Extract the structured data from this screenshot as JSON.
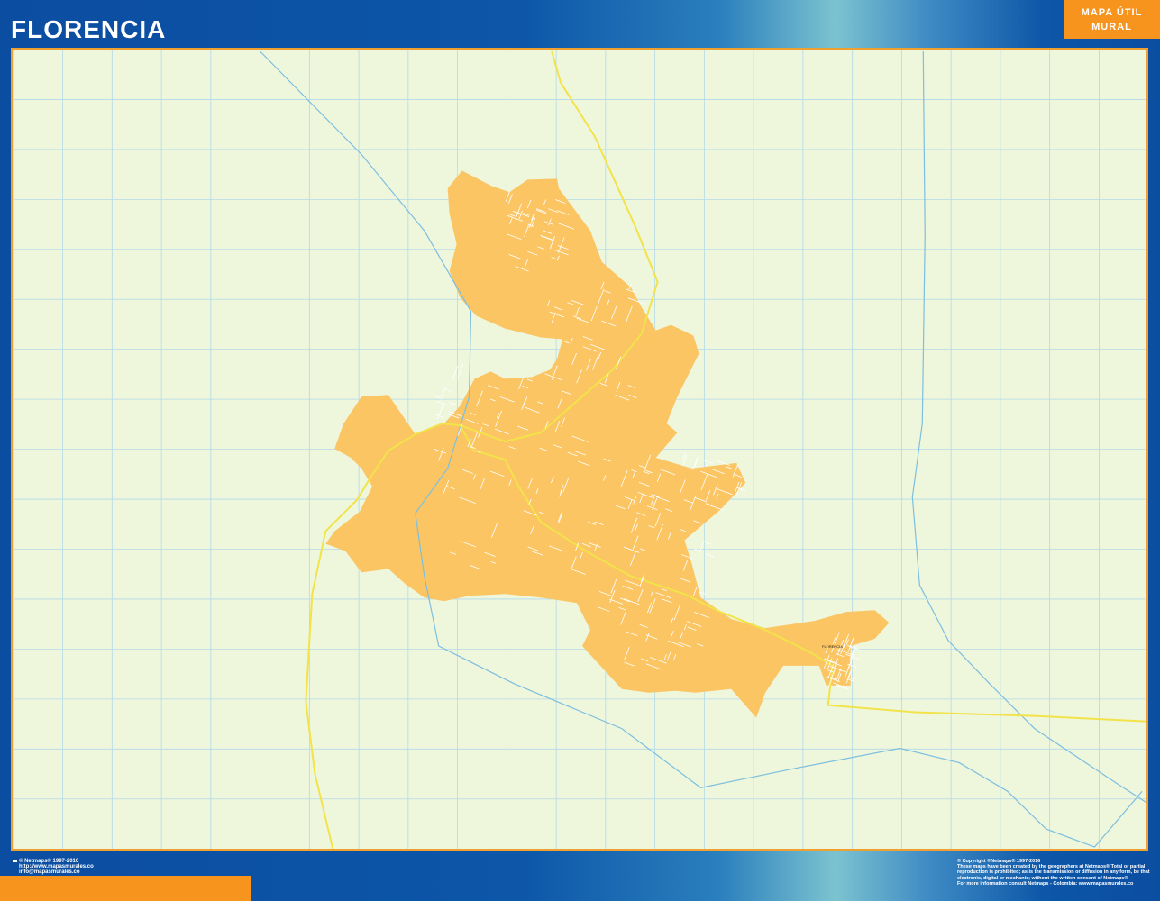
{
  "header": {
    "title": "FLORENCIA",
    "brand_line1": "MAPA ÚTIL",
    "brand_line2": "MURAL"
  },
  "map": {
    "place_label": "FLORENCIA",
    "colors": {
      "background": "#eef6dc",
      "urban_area": "#fbc563",
      "grid": "#a9d4e6",
      "river": "#7cbfe0",
      "main_road": "#f2e34a",
      "frame": "#f0a030"
    }
  },
  "footer": {
    "left": [
      "© Netmaps® 1997-2016",
      "http://www.mapasmurales.co",
      "info@mapasmurales.co"
    ],
    "right": [
      "© Copyright ©Netmaps® 1997-2016",
      "These maps have been created by the geographers at Netmaps® Total or partial",
      "reproduction is prohibited; as is the transmission or diffusion in any form, be that",
      "electronic, digital or mechanic; without the written consent of Netmaps®",
      "For more information consult Netmaps - Colombia: www.mapasmurales.co"
    ]
  }
}
